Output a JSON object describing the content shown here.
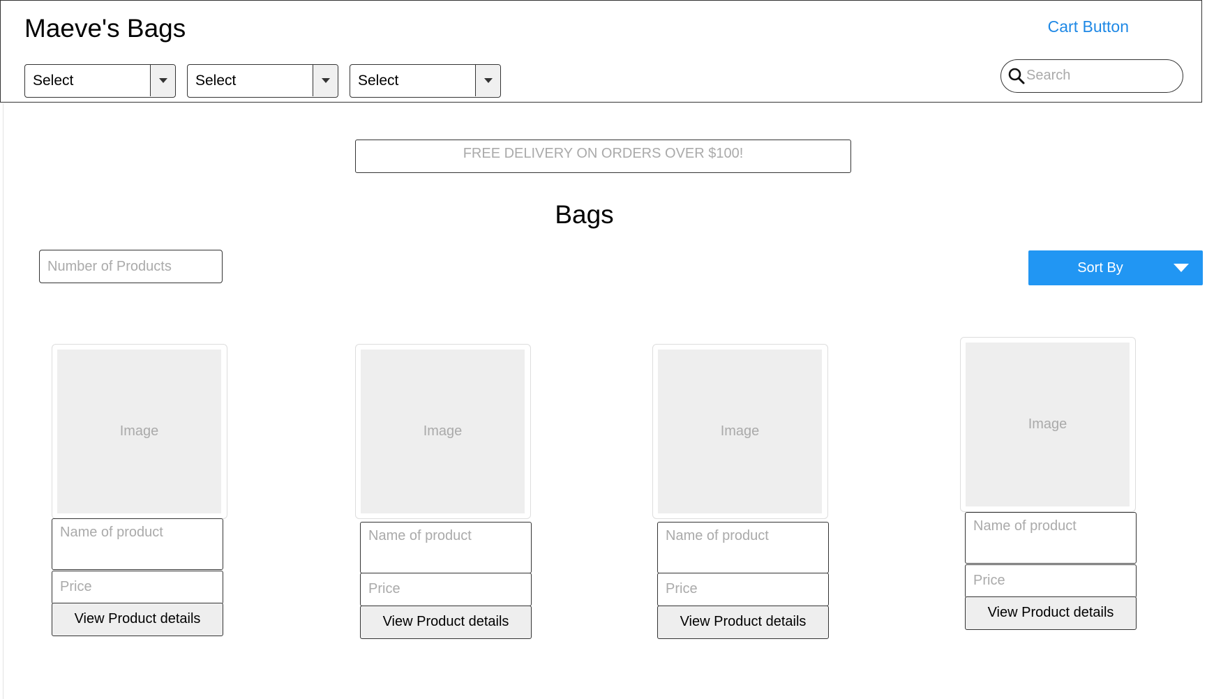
{
  "header": {
    "brand": "Maeve's Bags",
    "cart_label": "Cart Button",
    "filters": [
      {
        "label": "Select"
      },
      {
        "label": "Select"
      },
      {
        "label": "Select"
      }
    ],
    "search": {
      "placeholder": "Search"
    }
  },
  "banner": {
    "text": "FREE DELIVERY ON ORDERS OVER $100!"
  },
  "main": {
    "title": "Bags",
    "product_count_placeholder": "Number of Products",
    "sort_label": "Sort By",
    "products": [
      {
        "image": "Image",
        "name": "Name of product",
        "price": "Price",
        "button": "View Product details"
      },
      {
        "image": "Image",
        "name": "Name of product",
        "price": "Price",
        "button": "View Product details"
      },
      {
        "image": "Image",
        "name": "Name of product",
        "price": "Price",
        "button": "View Product details"
      },
      {
        "image": "Image",
        "name": "Name of product",
        "price": "Price",
        "button": "View Product details"
      }
    ]
  },
  "colors": {
    "accent": "#2196f3",
    "link": "#1e88e5",
    "placeholder_text": "#aaaaaa",
    "image_fill": "#eeeeee"
  }
}
